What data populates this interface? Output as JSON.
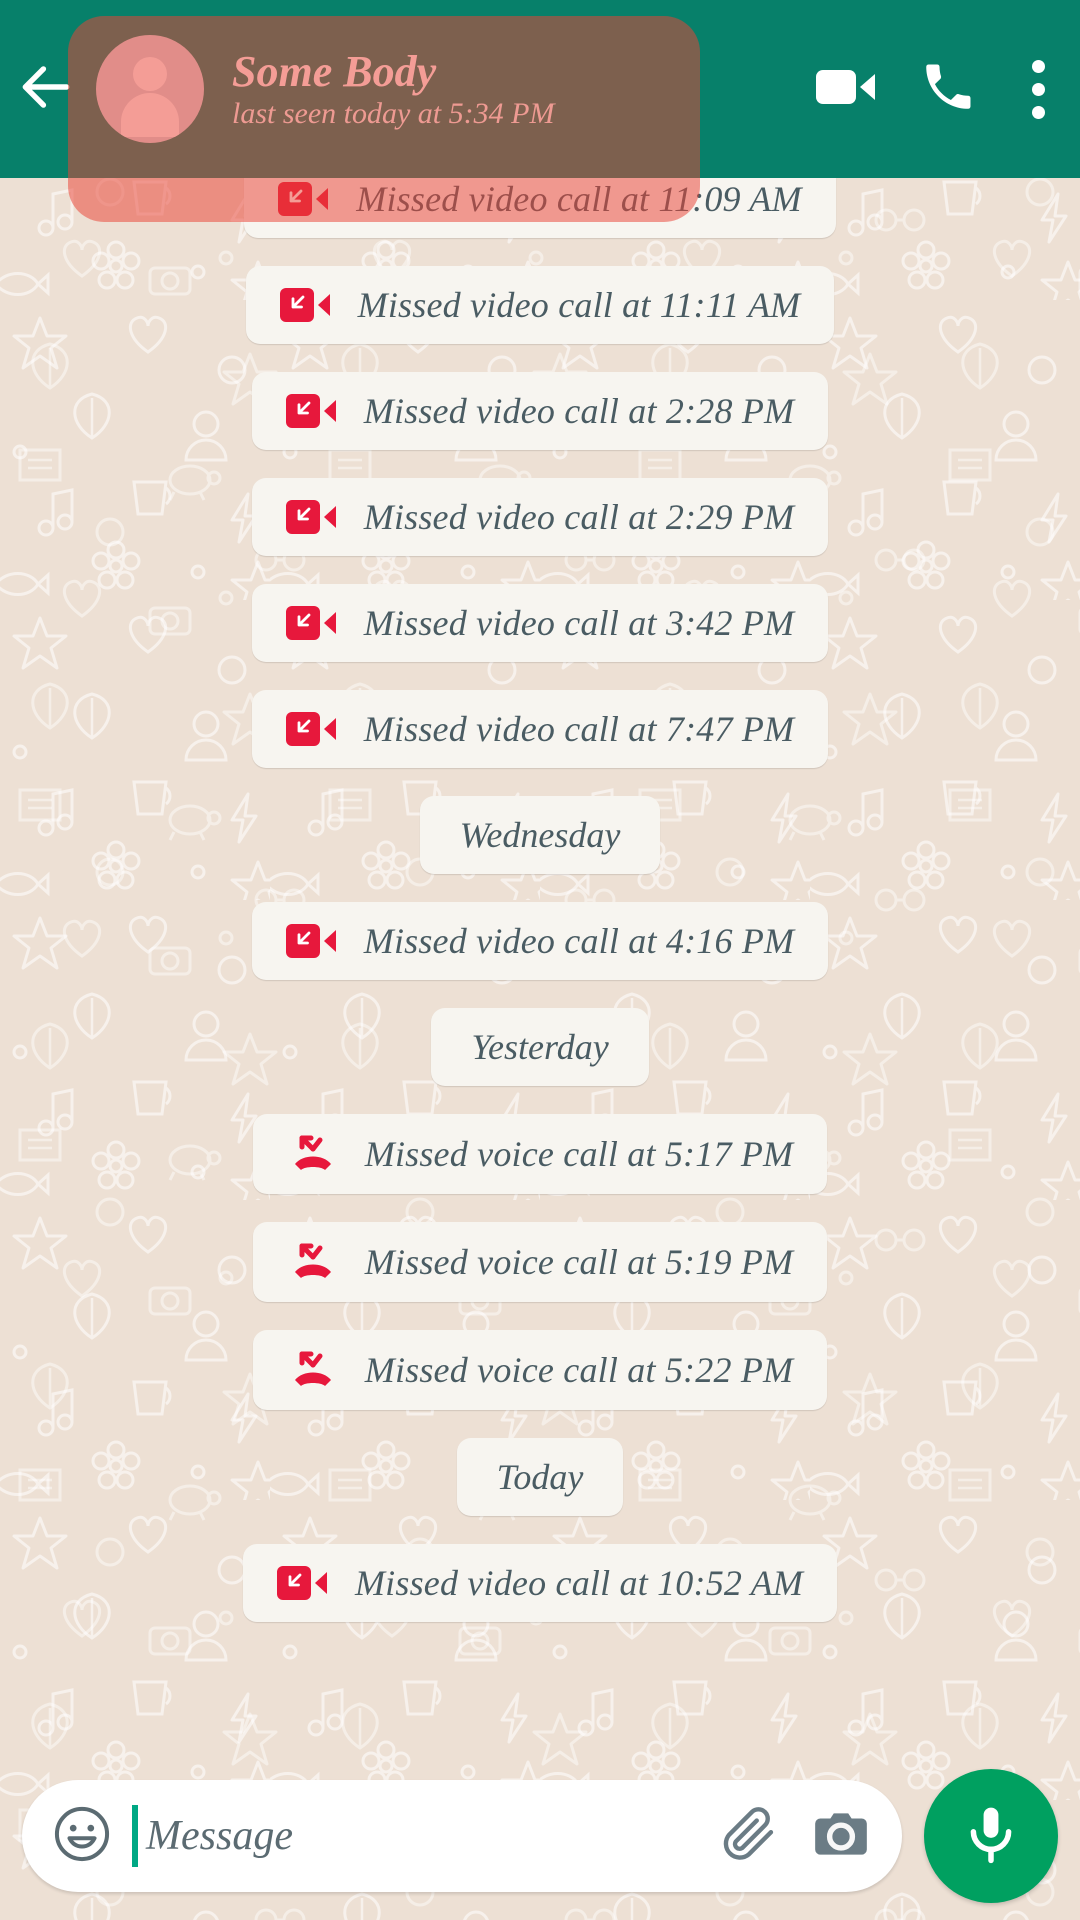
{
  "app": {
    "accent_green": "#07806A",
    "wallpaper_color": "#EDE0D4",
    "bubble_color": "#F7F5F0",
    "missed_call_red": "#E7183C",
    "mic_button_green": "#00A060",
    "highlight_overlay_color": "rgba(234,67,53,0.52)"
  },
  "appbar": {
    "back_icon": "arrow-left-icon",
    "avatar_icon": "default-contact-avatar",
    "contact_name": "Some Body",
    "contact_status": "last seen today at 5:34 PM",
    "video_call_icon": "video-camera-icon",
    "voice_call_icon": "phone-icon",
    "overflow_icon": "more-vertical-icon"
  },
  "chat": {
    "items": [
      {
        "type": "call",
        "call_kind": "video",
        "icon": "missed-video-call-icon",
        "label": "Missed video call at 11:09 AM",
        "clipped": true
      },
      {
        "type": "call",
        "call_kind": "video",
        "icon": "missed-video-call-icon",
        "label": "Missed video call at 11:11 AM"
      },
      {
        "type": "call",
        "call_kind": "video",
        "icon": "missed-video-call-icon",
        "label": "Missed video call at 2:28 PM"
      },
      {
        "type": "call",
        "call_kind": "video",
        "icon": "missed-video-call-icon",
        "label": "Missed video call at 2:29 PM"
      },
      {
        "type": "call",
        "call_kind": "video",
        "icon": "missed-video-call-icon",
        "label": "Missed video call at 3:42 PM"
      },
      {
        "type": "call",
        "call_kind": "video",
        "icon": "missed-video-call-icon",
        "label": "Missed video call at 7:47 PM"
      },
      {
        "type": "date",
        "label": "Wednesday"
      },
      {
        "type": "call",
        "call_kind": "video",
        "icon": "missed-video-call-icon",
        "label": "Missed video call at 4:16 PM"
      },
      {
        "type": "date",
        "label": "Yesterday"
      },
      {
        "type": "call",
        "call_kind": "voice",
        "icon": "missed-voice-call-icon",
        "label": "Missed voice call at 5:17 PM"
      },
      {
        "type": "call",
        "call_kind": "voice",
        "icon": "missed-voice-call-icon",
        "label": "Missed voice call at 5:19 PM"
      },
      {
        "type": "call",
        "call_kind": "voice",
        "icon": "missed-voice-call-icon",
        "label": "Missed voice call at 5:22 PM"
      },
      {
        "type": "date",
        "label": "Today"
      },
      {
        "type": "call",
        "call_kind": "video",
        "icon": "missed-video-call-icon",
        "label": "Missed video call at 10:52 AM"
      }
    ]
  },
  "composer": {
    "emoji_icon": "smiley-icon",
    "placeholder": "Message",
    "value": "",
    "attach_icon": "paperclip-icon",
    "camera_icon": "camera-icon",
    "mic_icon": "microphone-icon"
  }
}
